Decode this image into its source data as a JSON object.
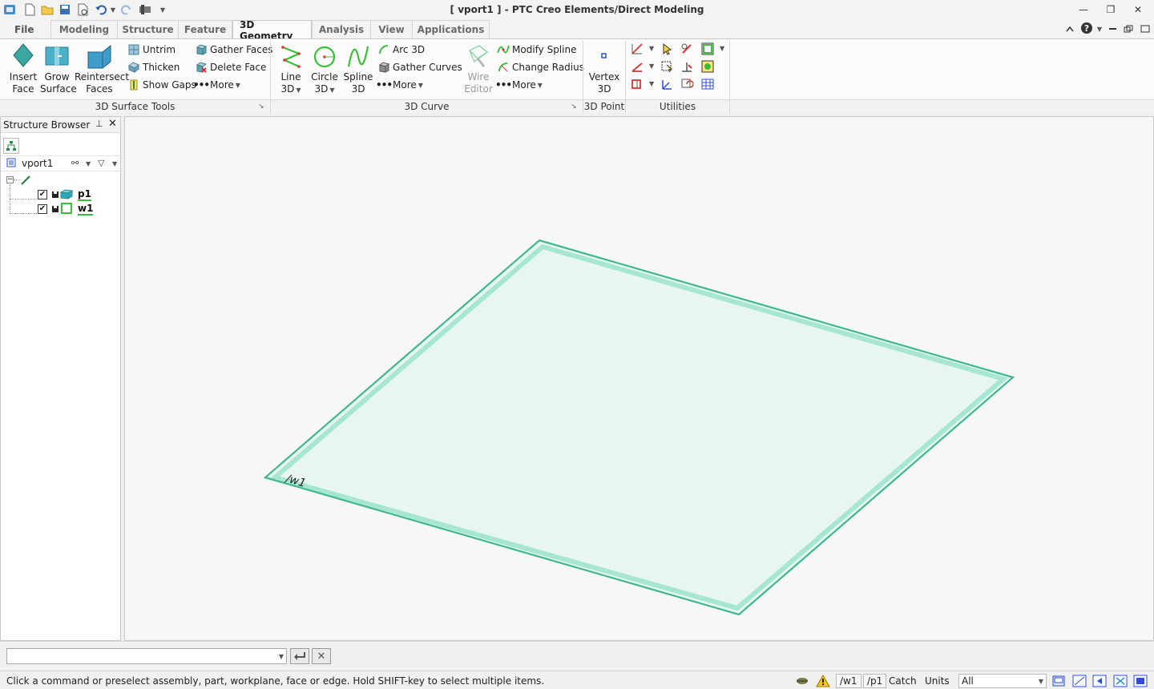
{
  "window": {
    "title": "[ vport1 ] - PTC Creo Elements/Direct Modeling",
    "minimize": "—",
    "maximize": "❐",
    "close": "✕"
  },
  "tabs": [
    {
      "label": "File"
    },
    {
      "label": "Modeling"
    },
    {
      "label": "Structure"
    },
    {
      "label": "Feature"
    },
    {
      "label": "3D Geometry"
    },
    {
      "label": "Analysis"
    },
    {
      "label": "View"
    },
    {
      "label": "Applications"
    }
  ],
  "ribbon": {
    "surface_tools": {
      "label": "3D Surface Tools",
      "insert_face": [
        "Insert",
        "Face"
      ],
      "grow_surface": [
        "Grow",
        "Surface"
      ],
      "reintersect_faces": [
        "Reintersect",
        "Faces"
      ],
      "untrim": "Untrim",
      "thicken": "Thicken",
      "show_gaps": "Show Gaps",
      "gather_faces": "Gather Faces",
      "delete_face": "Delete Face",
      "more": "More"
    },
    "curve": {
      "label": "3D Curve",
      "line": [
        "Line",
        "3D"
      ],
      "circle": [
        "Circle",
        "3D"
      ],
      "spline": [
        "Spline",
        "3D"
      ],
      "arc": "Arc 3D",
      "gather_curves": "Gather Curves",
      "more": "More",
      "wire_editor": [
        "Wire",
        "Editor"
      ],
      "modify_spline": "Modify Spline",
      "change_radius": "Change Radius",
      "more2": "More"
    },
    "point": {
      "label": "3D Point",
      "vertex": [
        "Vertex",
        "3D"
      ]
    },
    "utilities": {
      "label": "Utilities"
    }
  },
  "browser": {
    "title": "Structure Browser",
    "root": "vport1",
    "items": [
      {
        "name": "p1"
      },
      {
        "name": "w1"
      }
    ]
  },
  "viewport": {
    "workplane_label": "/w1"
  },
  "statusbar": {
    "message": "Click a command or preselect assembly, part, workplane, face or edge. Hold SHIFT-key to select multiple items.",
    "workplane": "/w1",
    "part": "/p1",
    "catch": "Catch",
    "units": "Units",
    "filter": "All"
  },
  "colors": {
    "accent": "#3cc08a",
    "face_fill": "#e6f7f1",
    "edge": "#41b894"
  }
}
